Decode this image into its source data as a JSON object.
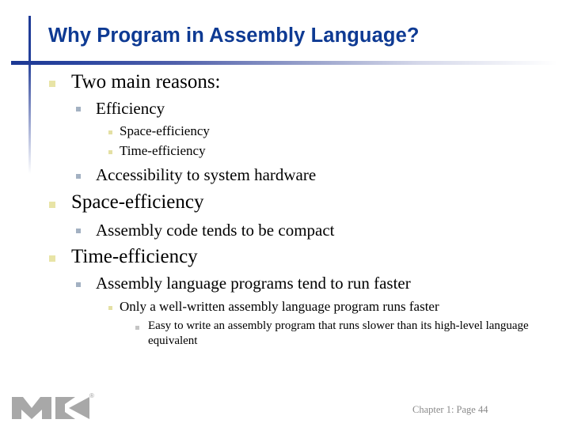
{
  "slide": {
    "title": "Why Program in Assembly Language?",
    "bullets": [
      {
        "level": 1,
        "text": "Two main reasons:"
      },
      {
        "level": 2,
        "text": "Efficiency"
      },
      {
        "level": 3,
        "text": "Space-efficiency"
      },
      {
        "level": 3,
        "text": "Time-efficiency"
      },
      {
        "level": 2,
        "text": "Accessibility to system hardware"
      },
      {
        "level": 1,
        "text": "Space-efficiency"
      },
      {
        "level": 2,
        "text": "Assembly code tends to be compact"
      },
      {
        "level": 1,
        "text": "Time-efficiency"
      },
      {
        "level": 2,
        "text": "Assembly language programs tend to run faster"
      },
      {
        "level": 3,
        "text": "Only a well-written assembly language program runs faster"
      },
      {
        "level": 4,
        "text": "Easy to write an assembly program that runs slower than its high-level language equivalent"
      }
    ],
    "footer": "Chapter 1: Page 44",
    "logo": {
      "name": "mk-publisher-logo",
      "registered_mark": "®"
    }
  },
  "colors": {
    "title": "#0e3a93",
    "accent_bar": "#1c3893",
    "bullet_level1": "#e8e4a6",
    "bullet_level2": "#a3b1c2",
    "bullet_level3": "#e4e0a4",
    "bullet_level4": "#c4c4c4",
    "footer": "#8a8a8a",
    "logo": "#a8a8a8"
  }
}
